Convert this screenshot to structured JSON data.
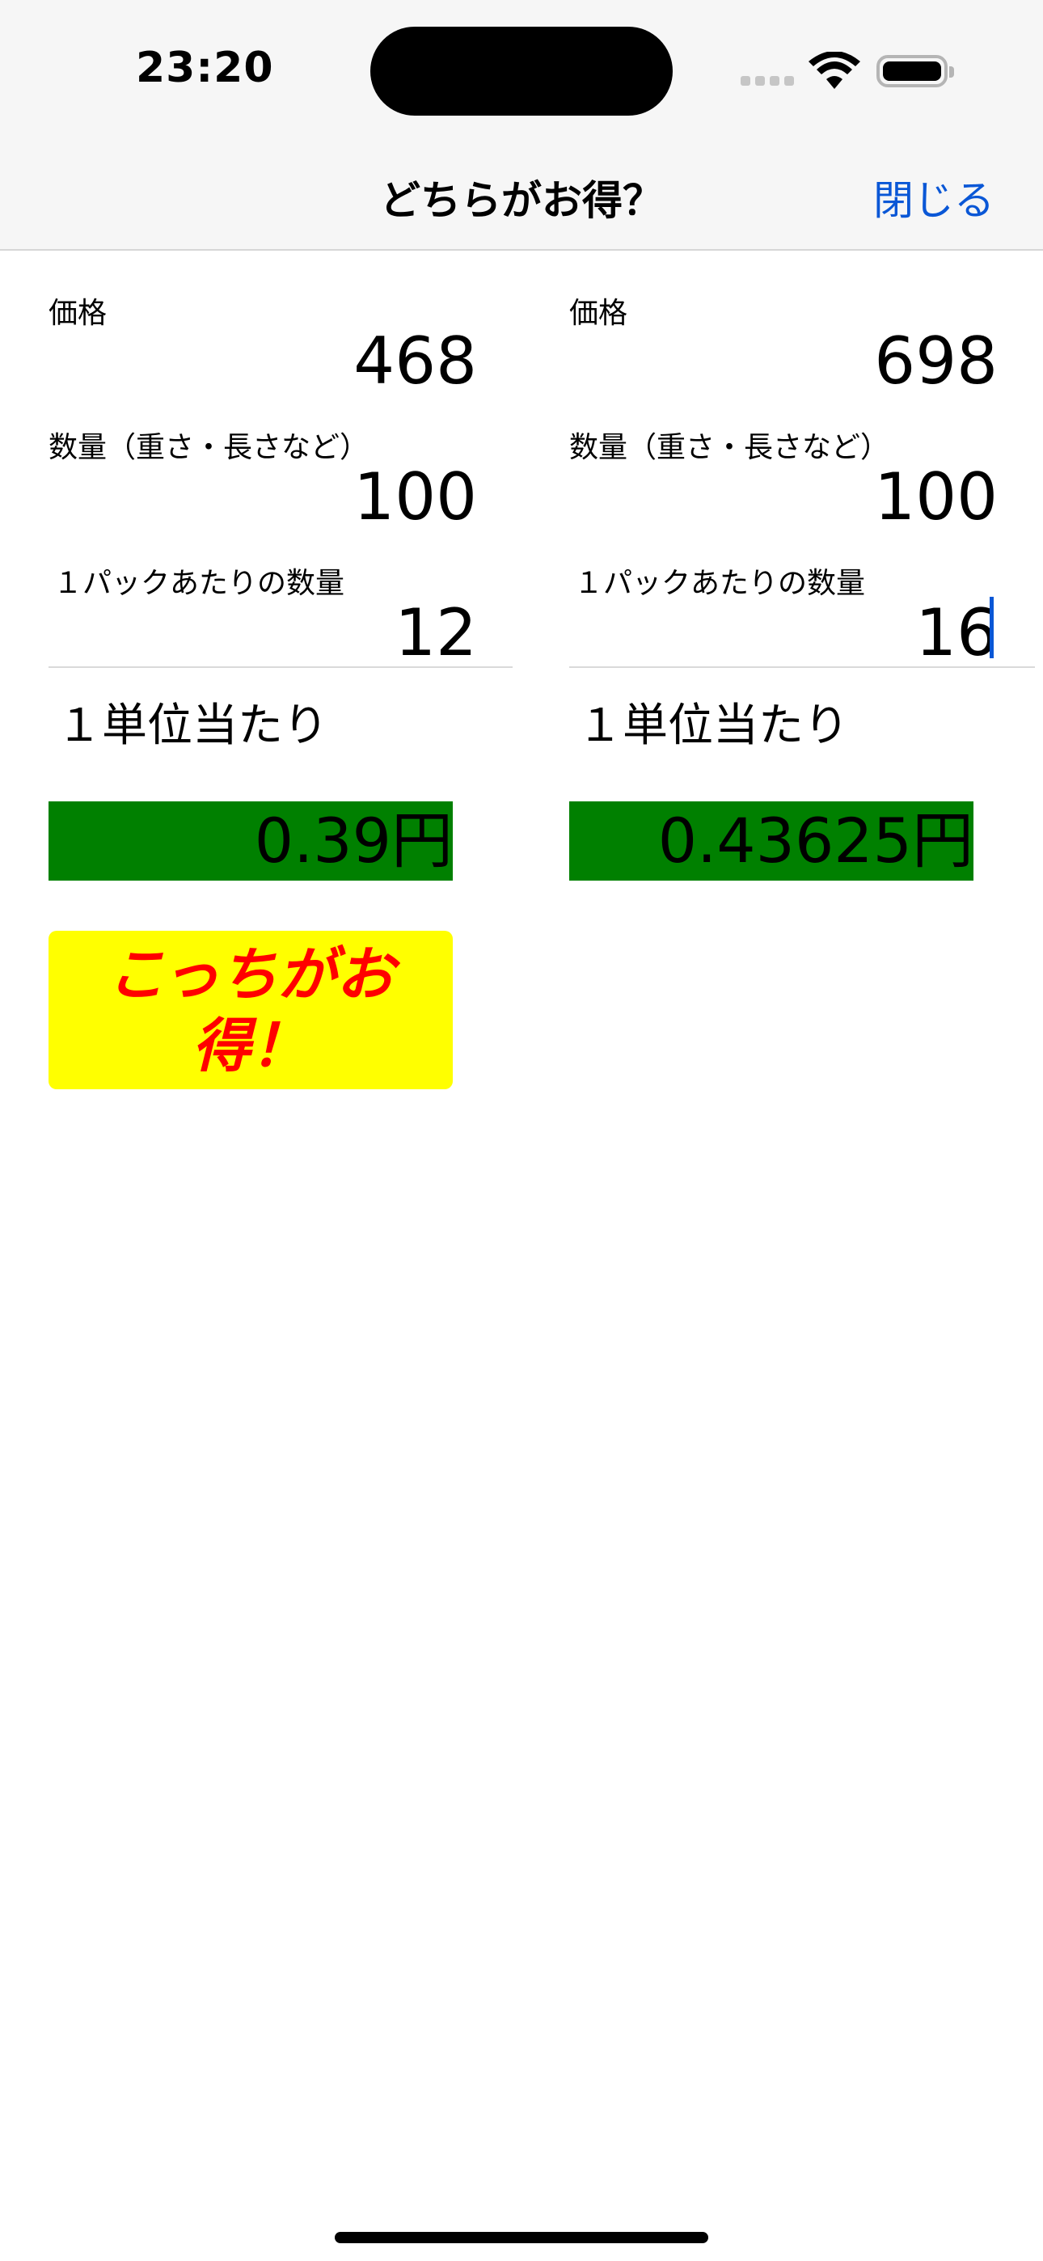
{
  "status_bar": {
    "time": "23:20",
    "icons": [
      "cellular-signal-icon",
      "wifi-icon",
      "battery-icon"
    ]
  },
  "nav": {
    "title": "どちらがお得？",
    "close_label": "閉じる"
  },
  "left": {
    "price_label": "価格",
    "price_value": "468",
    "amount_label": "数量（重さ・長さなど）",
    "amount_value": "100",
    "per_pack_label": "１パックあたりの数量",
    "per_pack_value": "12",
    "unit_label": "１単位当たり",
    "unit_price": "0.39円",
    "winner_line1": "こっちがお",
    "winner_line2": "得！"
  },
  "right": {
    "price_label": "価格",
    "price_value": "698",
    "amount_label": "数量（重さ・長さなど）",
    "amount_value": "100",
    "per_pack_label": "１パックあたりの数量",
    "per_pack_value": "16",
    "unit_label": "１単位当たり",
    "unit_price": "0.43625円"
  },
  "colors": {
    "accent": "#0a57d6",
    "unit_price_bg": "#008000",
    "winner_bg": "#ffff00",
    "winner_text": "#ff0000"
  }
}
